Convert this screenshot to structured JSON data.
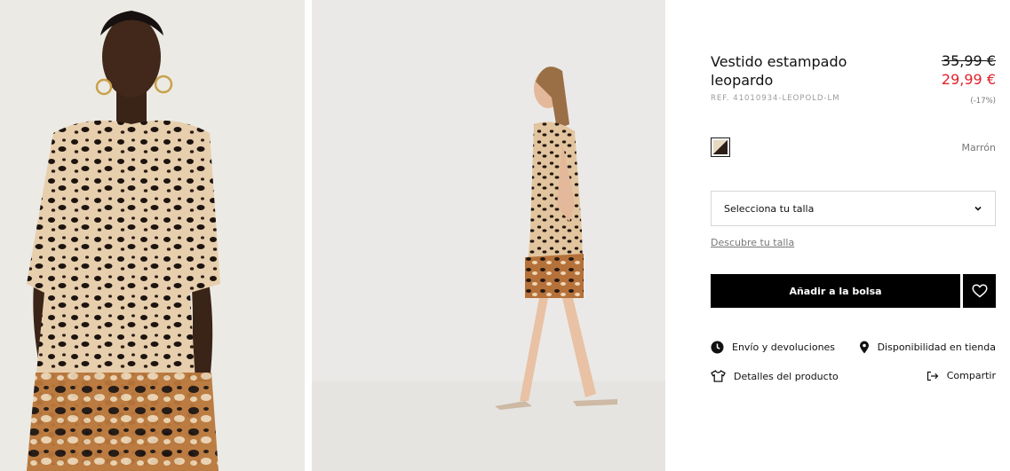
{
  "product": {
    "title": "Vestido estampado leopardo",
    "ref": "REF. 41010934-LEOPOLD-LM",
    "price_old": "35,99 €",
    "price_new": "29,99 €",
    "discount": "(-17%)",
    "color_name": "Marrón"
  },
  "size_select": {
    "placeholder": "Selecciona tu talla",
    "guide_link": "Descubre tu talla"
  },
  "actions": {
    "add_to_bag": "Añadir a la bolsa"
  },
  "links": {
    "shipping": "Envío y devoluciones",
    "stores": "Disponibilidad en tienda",
    "details": "Detalles del producto",
    "share": "Compartir"
  },
  "colors": {
    "accent_price": "#e0222c",
    "button": "#000000"
  },
  "icons": {
    "swatch": "color-swatch",
    "size_chevron": "chevron-down-icon",
    "favorite": "heart-icon",
    "shipping": "clock-icon",
    "stores": "map-pin-icon",
    "details": "tshirt-icon",
    "share": "share-icon"
  }
}
